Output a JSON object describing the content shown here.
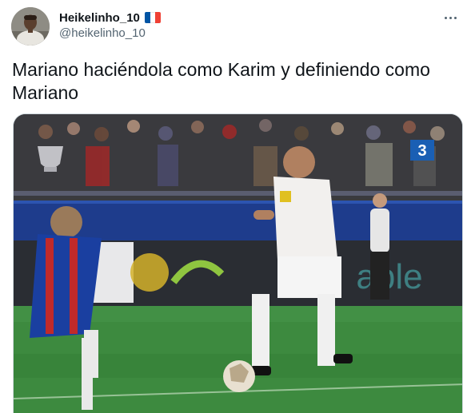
{
  "author": {
    "display_name": "Heikelinho_10",
    "handle": "@heikelinho_10",
    "flag_colors": [
      "#0055a4",
      "#ffffff",
      "#ef4135"
    ]
  },
  "tweet": {
    "text": "Mariano haciéndola como Karim y definiendo como Mariano"
  },
  "media": {
    "channel_logo": "3",
    "ad_board_text": "able"
  },
  "icons": {
    "more": "more-options-icon",
    "flag": "france-flag-icon"
  },
  "colors": {
    "text_primary": "#0f1419",
    "text_secondary": "#536471",
    "pitch": "#3d8a3f"
  }
}
